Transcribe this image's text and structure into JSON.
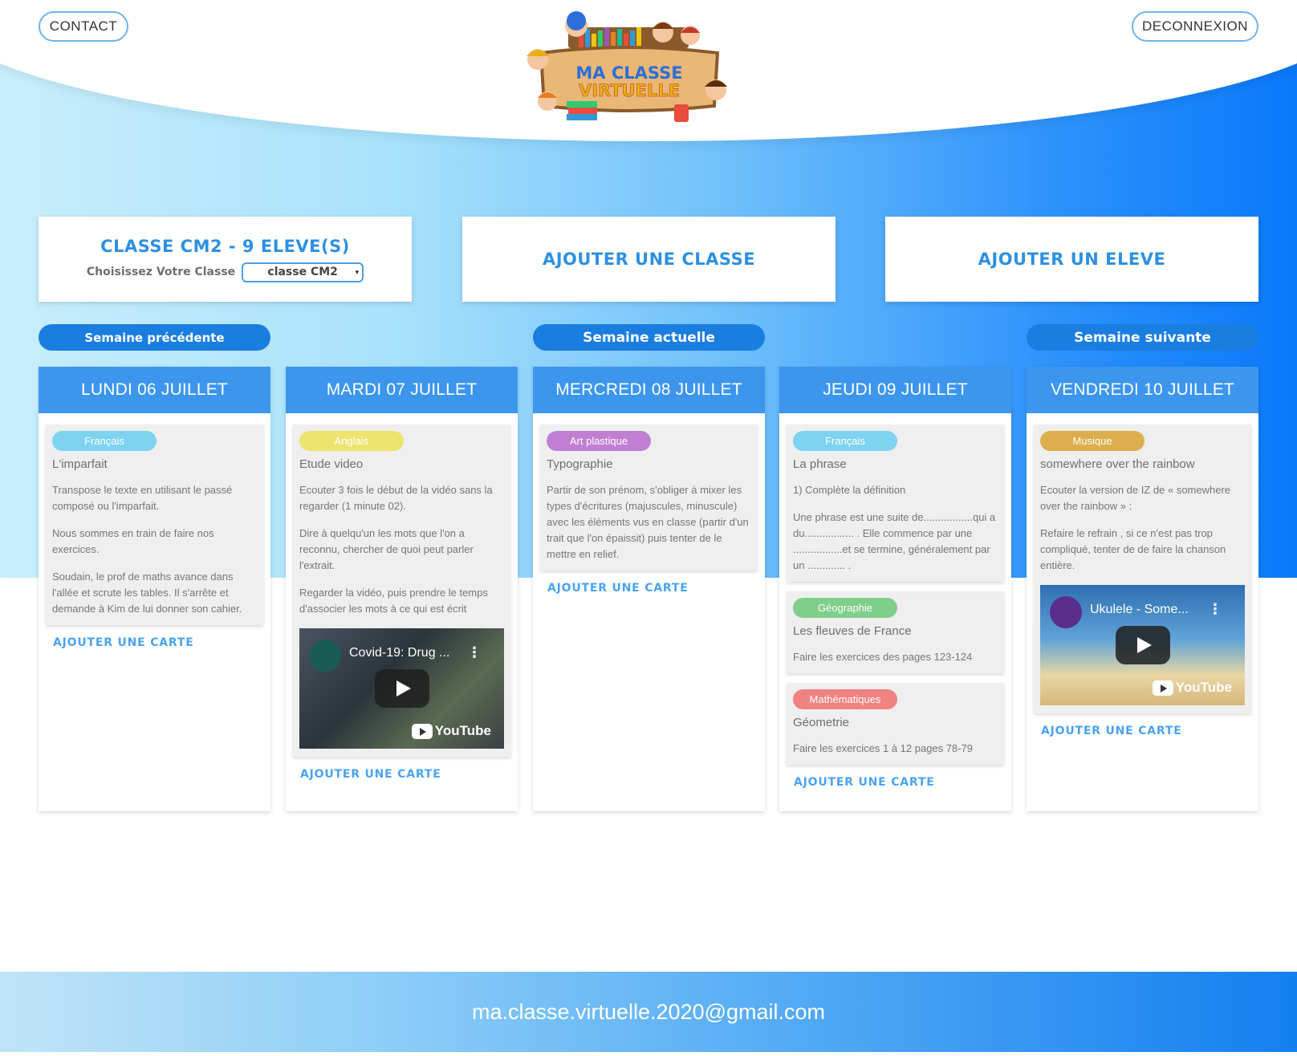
{
  "header": {
    "contact_label": "CONTACT",
    "logout_label": "DECONNEXION",
    "logo_line1": "MA CLASSE",
    "logo_line2": "VIRTUELLE"
  },
  "class_panel": {
    "title": "CLASSE CM2 - 9 ELEVE(S)",
    "select_label": "Choisissez Votre Classe",
    "select_value": "classe CM2"
  },
  "actions": {
    "add_class": "AJOUTER UNE CLASSE",
    "add_student": "AJOUTER UN ELEVE"
  },
  "week_nav": {
    "previous": "Semaine précédente",
    "current": "Semaine actuelle",
    "next": "Semaine suivante"
  },
  "add_card_label": "AJOUTER UNE CARTE",
  "tag_colors": {
    "Français": "#7dd3f0",
    "Anglais": "#ece46e",
    "Art plastique": "#c17fd3",
    "Géographie": "#7fcf8a",
    "Mathématiques": "#f08282",
    "Musique": "#dcae4e"
  },
  "days": [
    {
      "title": "LUNDI 06 JUILLET",
      "cards": [
        {
          "tag": "Français",
          "title": "L'imparfait",
          "paragraphs": [
            "Transpose le texte en utilisant le passé composé ou l'imparfait.",
            "Nous sommes en train de faire nos exercices.",
            "Soudain, le prof de maths avance dans l'allée et scrute les tables. Il s'arrête et demande à Kim de lui donner son cahier."
          ]
        }
      ]
    },
    {
      "title": "MARDI 07 JUILLET",
      "cards": [
        {
          "tag": "Anglais",
          "title": "Etude video",
          "paragraphs": [
            "Ecouter 3 fois le début de la vidéo sans la regarder (1 minute 02).",
            "Dire à quelqu'un les mots que l'on a reconnu, chercher de quoi peut parler l'extrait.",
            "Regarder la vidéo, puis prendre le temps d'associer les mots à ce qui est écrit"
          ],
          "video": {
            "title": "Covid-19: Drug ...",
            "brand": "YouTube"
          }
        }
      ]
    },
    {
      "title": "MERCREDI 08 JUILLET",
      "cards": [
        {
          "tag": "Art plastique",
          "title": "Typographie",
          "paragraphs": [
            "Partir de son prénom, s'obliger à mixer les types d'écritures (majuscules, minuscule) avec les éléments vus en classe (partir d'un trait que l'on épaissit) puis tenter de le mettre en relief."
          ]
        }
      ]
    },
    {
      "title": "JEUDI 09 JUILLET",
      "cards": [
        {
          "tag": "Français",
          "title": "La phrase",
          "paragraphs": [
            "1) Complète la définition",
            "Une phrase est une suite de.................qui a du................. . Elle commence par une .................et se termine, généralement par un ............. ."
          ]
        },
        {
          "tag": "Géographie",
          "title": "Les fleuves de France",
          "paragraphs": [
            "Faire les exercices des pages 123-124"
          ]
        },
        {
          "tag": "Mathématiques",
          "title": "Géometrie",
          "paragraphs": [
            "Faire les exercices 1 à 12 pages 78-79"
          ]
        }
      ]
    },
    {
      "title": "VENDREDI 10 JUILLET",
      "cards": [
        {
          "tag": "Musique",
          "title": "somewhere over the rainbow",
          "paragraphs": [
            "Ecouter la version de IZ de « somewhere over the rainbow » :",
            "Refaire le refrain , si ce n'est pas trop compliqué, tenter de de faire la chanson entière."
          ],
          "video": {
            "title": "Ukulele - Some...",
            "brand": "YouTube"
          }
        }
      ]
    }
  ],
  "footer": {
    "email": "ma.classe.virtuelle.2020@gmail.com"
  }
}
